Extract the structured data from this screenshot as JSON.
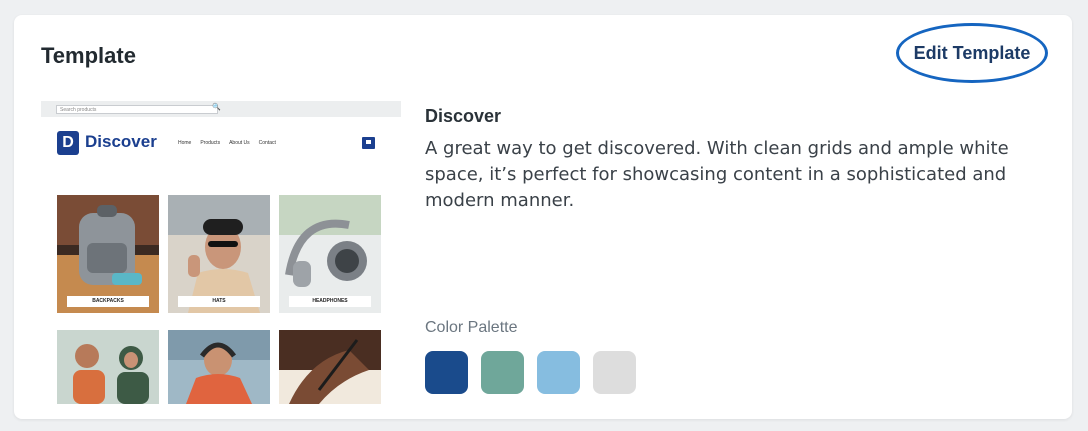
{
  "card": {
    "title": "Template",
    "edit_label": "Edit Template",
    "highlight_color": "#1565c0"
  },
  "preview": {
    "search_placeholder": "Search products",
    "logo_letter": "D",
    "logo_text": "Discover",
    "nav": [
      "Home",
      "Products",
      "About Us",
      "Contact"
    ],
    "tiles": [
      {
        "label": "BACKPACKS",
        "icon": "backpack-photo"
      },
      {
        "label": "HATS",
        "icon": "hat-photo"
      },
      {
        "label": "HEADPHONES",
        "icon": "headphones-photo"
      }
    ],
    "brand_color": "#1b3f8f"
  },
  "template": {
    "name": "Discover",
    "description": "A great way to get discovered. With clean grids and ample white space, it’s perfect for showcasing content in a sophisticated and modern manner."
  },
  "palette": {
    "label": "Color Palette",
    "colors": [
      "#1a4b8c",
      "#6fa79a",
      "#86bde0",
      "#dddddd"
    ]
  }
}
